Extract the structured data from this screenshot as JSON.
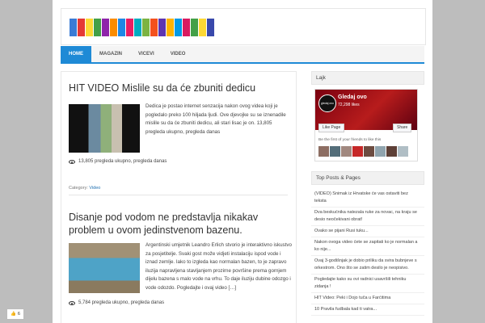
{
  "nav": {
    "items": [
      "HOME",
      "MAGAZIN",
      "VICEVI",
      "VIDEO"
    ]
  },
  "articles": [
    {
      "title": "HIT VIDEO Mislile su da će zbuniti dedicu",
      "excerpt": "Dedica je postao internet senzacija nakon ovog videa koji je pogledalo preko 100 hiljada ljudi. Ove djevojke su se iznenadile mislile su da će zbuniti dedicu, ali stari lisac je on. 13,805 pregleda ukupno, pregleda danas",
      "views": "13,805 pregleda ukupno, pregleda danas",
      "category_label": "Category:",
      "category": "Video"
    },
    {
      "title": "Disanje pod vodom ne predstavlja nikakav problem u ovom jedinstvenom bazenu.",
      "excerpt": "Argentinski umjetnik Leandro Erlich stvorio je interaktivno iskustvo za posjetitelje. Svaki gost može vidjeti instalaciju ispod vode i iznad zemlje. Iako to izgleda kao normalan bazen, to je zapravo iluzija napravljena stavljanjem prozirne površine prema gornjem dijelu bazena s malo vode na vrhu. To daje iluziju dubine odozgo i vode odozdo. Pogledajte i ovaj video […]",
      "views": "5,784 pregleda ukupno, pregleda danas"
    }
  ],
  "sidebar": {
    "like_title": "Lajk",
    "fb": {
      "avatar_text": "gledaj ovo",
      "name": "Gledaj ovo",
      "likes": "72,298 likes",
      "like_button": "Like Page",
      "share_button": "Share",
      "friends_text": "Be the first of your friends to like this"
    },
    "top_posts_title": "Top Posts & Pages",
    "top_posts": [
      "(VIDEO) Snimak iz Hrvatske će vas ostaviti bez teksta",
      "Dva beskućnika natezala ruke za novac, na kraju se desio neočekivani obrat!",
      "Ovako se pijani Rusi tuku...",
      "Nakon ovoga video ćete se zapitati ko je normalan a ko nije...",
      "Ovaj 3-godišnjak je dobio priliku da svira bubnjeve s orkestrom. Ono što se zatim desilo je neopisivo.",
      "Pogledajte kako su ovi radnici usavršili tehniku zidanja !",
      "HIT Video: Peki i Dojo tuča u Farćitima",
      "10 Pravila fudbala kad ti vatra..."
    ]
  },
  "fb_float": {
    "count": "6"
  },
  "colors": {
    "accent": "#1e8ad6",
    "fb_red": "#b71c1c"
  }
}
